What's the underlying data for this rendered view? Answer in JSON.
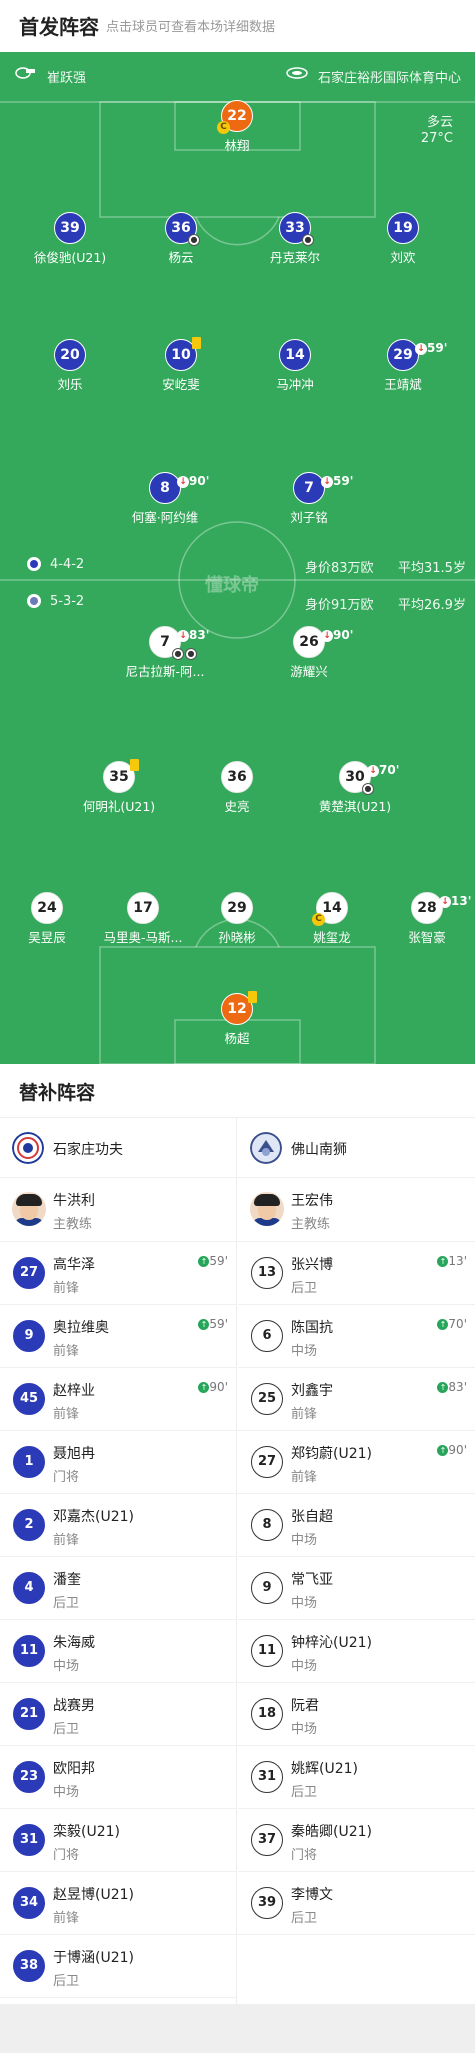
{
  "header": {
    "title": "首发阵容",
    "subtitle": "点击球员可查看本场详细数据"
  },
  "match_info": {
    "referee": "崔跃强",
    "stadium": "石家庄裕彤国际体育中心",
    "weather": "多云",
    "temperature": "27°C",
    "watermark": "懂球帝"
  },
  "home_team": {
    "name": "石家庄功夫",
    "formation": "4-4-2",
    "value": "身价83万欧",
    "avg_age": "平均31.5岁",
    "coach": "牛洪利",
    "coach_role": "主教练"
  },
  "away_team": {
    "name": "佛山南狮",
    "formation": "5-3-2",
    "value": "身价91万欧",
    "avg_age": "平均26.9岁",
    "coach": "王宏伟",
    "coach_role": "主教练"
  },
  "home_lineup": [
    {
      "num": "22",
      "name": "林翔",
      "gk": true,
      "captain": true
    },
    {
      "num": "39",
      "name": "徐俊驰(U21)"
    },
    {
      "num": "36",
      "name": "杨云",
      "goal": true
    },
    {
      "num": "33",
      "name": "丹克莱尔",
      "goal": true
    },
    {
      "num": "19",
      "name": "刘欢"
    },
    {
      "num": "20",
      "name": "刘乐"
    },
    {
      "num": "10",
      "name": "安屹斐",
      "yellow": true
    },
    {
      "num": "14",
      "name": "马冲冲"
    },
    {
      "num": "29",
      "name": "王靖斌",
      "sub_min": "59'"
    },
    {
      "num": "8",
      "name": "何塞·阿约维",
      "sub_min": "90'"
    },
    {
      "num": "7",
      "name": "刘子铭",
      "sub_min": "59'"
    }
  ],
  "away_lineup": [
    {
      "num": "7",
      "name": "尼古拉斯-阿...",
      "sub_min": "83'",
      "goals": 2
    },
    {
      "num": "26",
      "name": "游耀兴",
      "sub_min": "90'"
    },
    {
      "num": "35",
      "name": "何明礼(U21)",
      "yellow": true
    },
    {
      "num": "36",
      "name": "史亮"
    },
    {
      "num": "30",
      "name": "黄楚淇(U21)",
      "sub_min": "70'",
      "goal": true
    },
    {
      "num": "24",
      "name": "吴昱辰"
    },
    {
      "num": "17",
      "name": "马里奥-马斯..."
    },
    {
      "num": "29",
      "name": "孙晓彬"
    },
    {
      "num": "14",
      "name": "姚玺龙",
      "captain": true
    },
    {
      "num": "28",
      "name": "张智豪",
      "sub_min": "13'"
    },
    {
      "num": "12",
      "name": "杨超",
      "gk": true,
      "yellow": true
    }
  ],
  "substitutes_title": "替补阵容",
  "home_subs": [
    {
      "num": "27",
      "name": "高华泽",
      "pos": "前锋",
      "min": "59'"
    },
    {
      "num": "9",
      "name": "奥拉维奥",
      "pos": "前锋",
      "min": "59'"
    },
    {
      "num": "45",
      "name": "赵梓业",
      "pos": "前锋",
      "min": "90'"
    },
    {
      "num": "1",
      "name": "聂旭冉",
      "pos": "门将"
    },
    {
      "num": "2",
      "name": "邓嘉杰(U21)",
      "pos": "前锋"
    },
    {
      "num": "4",
      "name": "潘奎",
      "pos": "后卫"
    },
    {
      "num": "11",
      "name": "朱海威",
      "pos": "中场"
    },
    {
      "num": "21",
      "name": "战赛男",
      "pos": "后卫"
    },
    {
      "num": "23",
      "name": "欧阳邦",
      "pos": "中场"
    },
    {
      "num": "31",
      "name": "栾毅(U21)",
      "pos": "门将"
    },
    {
      "num": "34",
      "name": "赵昱博(U21)",
      "pos": "前锋"
    },
    {
      "num": "38",
      "name": "于博涵(U21)",
      "pos": "后卫"
    }
  ],
  "away_subs": [
    {
      "num": "13",
      "name": "张兴博",
      "pos": "后卫",
      "min": "13'"
    },
    {
      "num": "6",
      "name": "陈国抗",
      "pos": "中场",
      "min": "70'"
    },
    {
      "num": "25",
      "name": "刘鑫宇",
      "pos": "前锋",
      "min": "83'"
    },
    {
      "num": "27",
      "name": "郑钧蔚(U21)",
      "pos": "前锋",
      "min": "90'"
    },
    {
      "num": "8",
      "name": "张自超",
      "pos": "中场"
    },
    {
      "num": "9",
      "name": "常飞亚",
      "pos": "中场"
    },
    {
      "num": "11",
      "name": "钟梓沁(U21)",
      "pos": "中场"
    },
    {
      "num": "18",
      "name": "阮君",
      "pos": "中场"
    },
    {
      "num": "31",
      "name": "姚辉(U21)",
      "pos": "后卫"
    },
    {
      "num": "37",
      "name": "秦皓卿(U21)",
      "pos": "门将"
    },
    {
      "num": "39",
      "name": "李博文",
      "pos": "后卫"
    }
  ],
  "colors": {
    "pitch": "#34a95b",
    "home": "#2b3bb7",
    "gk": "#ee6a12",
    "yellow_card": "#f6c80c",
    "sub_out": "#e53935",
    "sub_in": "#27a55a"
  }
}
